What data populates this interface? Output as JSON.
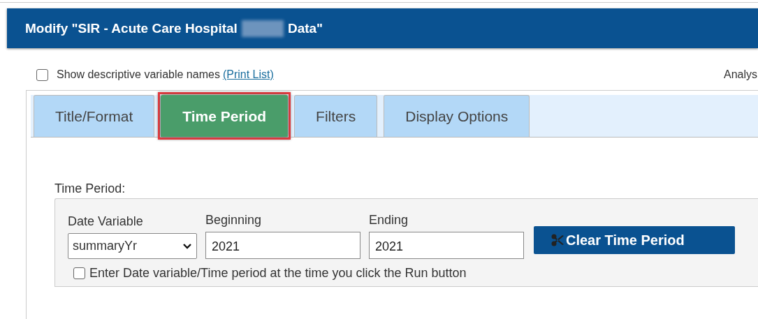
{
  "window": {
    "title_before": "Modify \"SIR - Acute Care Hospital",
    "title_redacted": true,
    "title_after": "Data\""
  },
  "options": {
    "show_descriptive": {
      "label": "Show descriptive variable names",
      "checked": false
    },
    "print_list": "(Print List)",
    "analysis_label": "Analys"
  },
  "tabs": [
    {
      "label": "Title/Format",
      "selected": false,
      "highlighted": false
    },
    {
      "label": "Time Period",
      "selected": true,
      "highlighted": true
    },
    {
      "label": "Filters",
      "selected": false,
      "highlighted": false
    },
    {
      "label": "Display Options",
      "selected": false,
      "highlighted": false
    }
  ],
  "time_period": {
    "heading": "Time Period:",
    "date_variable": {
      "label": "Date Variable",
      "value": "summaryYr"
    },
    "beginning": {
      "label": "Beginning",
      "value": "2021"
    },
    "ending": {
      "label": "Ending",
      "value": "2021"
    },
    "clear_button": "Clear Time Period",
    "run_prompt": {
      "label": "Enter Date variable/Time period at the time you click the Run button",
      "checked": false
    }
  }
}
